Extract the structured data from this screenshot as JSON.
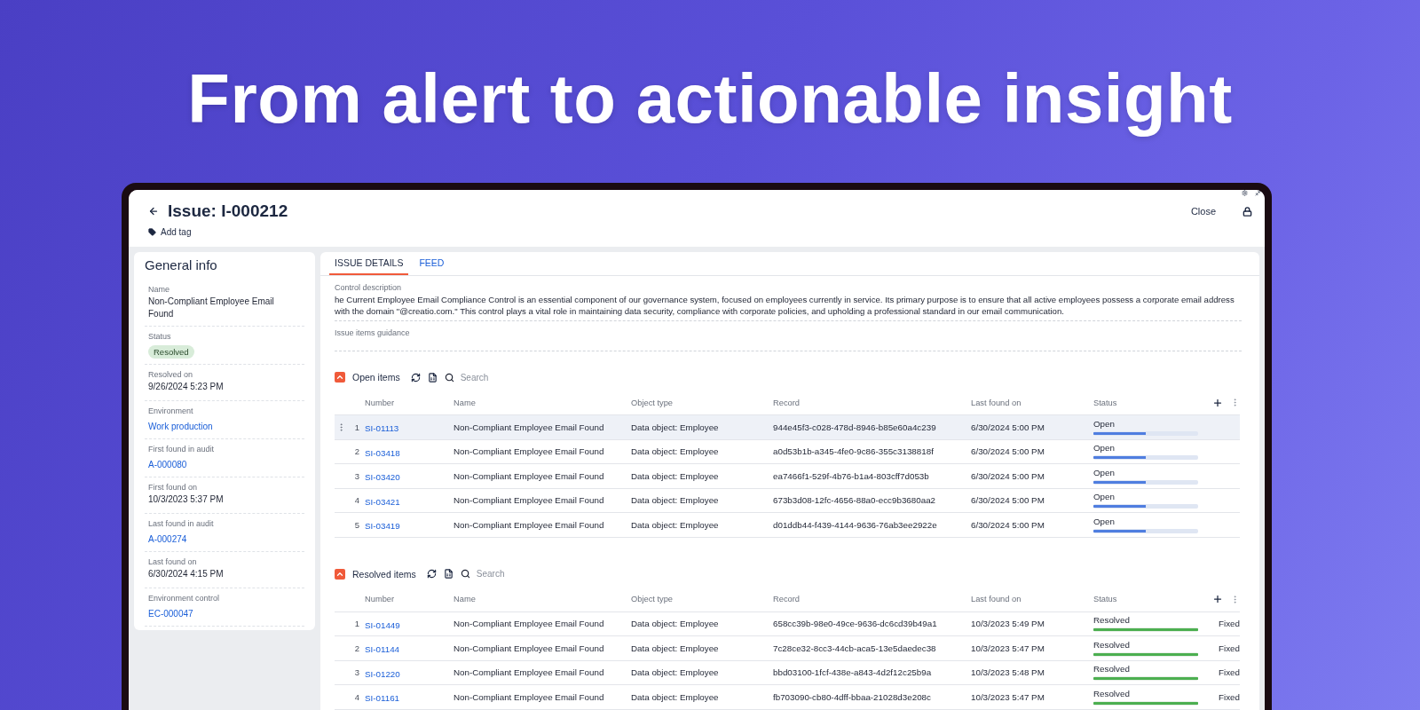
{
  "headline": "From alert to actionable insight",
  "header": {
    "title": "Issue: I-000212",
    "add_tag": "Add tag",
    "close": "Close"
  },
  "general_info": {
    "title": "General info",
    "fields": [
      {
        "label": "Name",
        "value": "Non-Compliant Employee Email Found",
        "kind": "text"
      },
      {
        "label": "Status",
        "value": "Resolved",
        "kind": "badge"
      },
      {
        "label": "Resolved on",
        "value": "9/26/2024 5:23 PM",
        "kind": "text"
      },
      {
        "label": "Environment",
        "value": "Work production",
        "kind": "link"
      },
      {
        "label": "First found in audit",
        "value": "A-000080",
        "kind": "link"
      },
      {
        "label": "First found on",
        "value": "10/3/2023 5:37 PM",
        "kind": "text"
      },
      {
        "label": "Last found in audit",
        "value": "A-000274",
        "kind": "link"
      },
      {
        "label": "Last found on",
        "value": "6/30/2024 4:15 PM",
        "kind": "text"
      },
      {
        "label": "Environment control",
        "value": "EC-000047",
        "kind": "link"
      }
    ]
  },
  "tabs": [
    {
      "label": "ISSUE DETAILS",
      "selected": true
    },
    {
      "label": "FEED",
      "selected": false
    }
  ],
  "control_description": {
    "label": "Control description",
    "text": "he Current Employee Email Compliance Control is an essential component of our governance system, focused on employees currently in service. Its primary purpose is to ensure that all active employees possess a corporate email address with the domain \"@creatio.com.\" This control plays a vital role in maintaining data security, compliance with corporate policies, and upholding a professional standard in our email communication."
  },
  "issue_items_guidance": {
    "label": "Issue items guidance"
  },
  "tables": [
    {
      "title": "Open items",
      "kind": "open",
      "search": {
        "placeholder": "Search"
      },
      "columns": [
        "Number",
        "Name",
        "Object type",
        "Record",
        "Last found on",
        "Status"
      ],
      "rows": [
        {
          "index": "1",
          "selected": true,
          "number": "SI-01113",
          "name": "Non-Compliant Employee Email Found",
          "object_type": "Data object: Employee",
          "record": "944e45f3-c028-478d-8946-b85e60a4c239",
          "last_found_on": "6/30/2024 5:00 PM",
          "status": "Open",
          "level": 0.5
        },
        {
          "index": "2",
          "selected": false,
          "number": "SI-03418",
          "name": "Non-Compliant Employee Email Found",
          "object_type": "Data object: Employee",
          "record": "a0d53b1b-a345-4fe0-9c86-355c3138818f",
          "last_found_on": "6/30/2024 5:00 PM",
          "status": "Open",
          "level": 0.5
        },
        {
          "index": "3",
          "selected": false,
          "number": "SI-03420",
          "name": "Non-Compliant Employee Email Found",
          "object_type": "Data object: Employee",
          "record": "ea7466f1-529f-4b76-b1a4-803cff7d053b",
          "last_found_on": "6/30/2024 5:00 PM",
          "status": "Open",
          "level": 0.5
        },
        {
          "index": "4",
          "selected": false,
          "number": "SI-03421",
          "name": "Non-Compliant Employee Email Found",
          "object_type": "Data object: Employee",
          "record": "673b3d08-12fc-4656-88a0-ecc9b3680aa2",
          "last_found_on": "6/30/2024 5:00 PM",
          "status": "Open",
          "level": 0.5
        },
        {
          "index": "5",
          "selected": false,
          "number": "SI-03419",
          "name": "Non-Compliant Employee Email Found",
          "object_type": "Data object: Employee",
          "record": "d01ddb44-f439-4144-9636-76ab3ee2922e",
          "last_found_on": "6/30/2024 5:00 PM",
          "status": "Open",
          "level": 0.5
        }
      ]
    },
    {
      "title": "Resolved items",
      "kind": "resolved",
      "search": {
        "placeholder": "Search"
      },
      "columns": [
        "Number",
        "Name",
        "Object type",
        "Record",
        "Last found on",
        "Status"
      ],
      "rows": [
        {
          "index": "1",
          "selected": false,
          "number": "SI-01449",
          "name": "Non-Compliant Employee Email Found",
          "object_type": "Data object: Employee",
          "record": "658cc39b-98e0-49ce-9636-dc6cd39b49a1",
          "last_found_on": "10/3/2023 5:49 PM",
          "status": "Resolved",
          "level": 1,
          "column_7": "Fixed"
        },
        {
          "index": "2",
          "selected": false,
          "number": "SI-01144",
          "name": "Non-Compliant Employee Email Found",
          "object_type": "Data object: Employee",
          "record": "7c28ce32-8cc3-44cb-aca5-13e5daedec38",
          "last_found_on": "10/3/2023 5:47 PM",
          "status": "Resolved",
          "level": 1,
          "column_7": "Fixed"
        },
        {
          "index": "3",
          "selected": false,
          "number": "SI-01220",
          "name": "Non-Compliant Employee Email Found",
          "object_type": "Data object: Employee",
          "record": "bbd03100-1fcf-438e-a843-4d2f12c25b9a",
          "last_found_on": "10/3/2023 5:48 PM",
          "status": "Resolved",
          "level": 1,
          "column_7": "Fixed"
        },
        {
          "index": "4",
          "selected": false,
          "number": "SI-01161",
          "name": "Non-Compliant Employee Email Found",
          "object_type": "Data object: Employee",
          "record": "fb703090-cb80-4dff-bbaa-21028d3e208c",
          "last_found_on": "10/3/2023 5:47 PM",
          "status": "Resolved",
          "level": 1,
          "column_7": "Fixed"
        }
      ]
    }
  ]
}
